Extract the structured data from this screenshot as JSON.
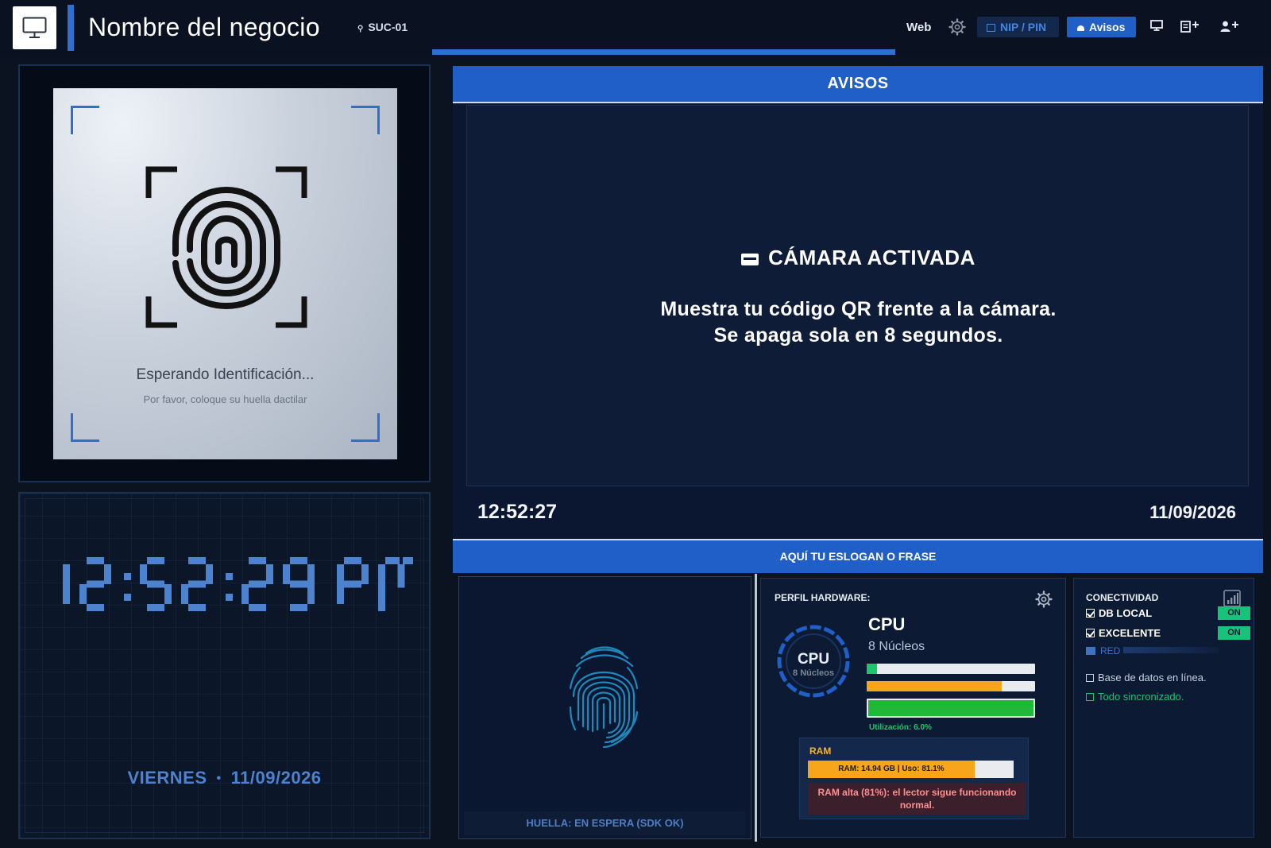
{
  "header": {
    "business_name": "Nombre del negocio",
    "branch": "SUC-01",
    "web_label": "Web",
    "nip_label": "NIP / PIN",
    "avisos_label": "Avisos",
    "icons": [
      "monitor-icon",
      "gear-icon",
      "keypad-icon",
      "bell-icon",
      "display-icon",
      "add-device-icon",
      "add-user-icon"
    ]
  },
  "reader": {
    "title": "Esperando Identificación...",
    "subtitle": "Por favor, coloque su huella dactilar"
  },
  "clock": {
    "time": "12:52:29 PM",
    "weekday": "VIERNES",
    "separator": "•",
    "date": "11/09/2026"
  },
  "avisos": {
    "header": "AVISOS",
    "camera_title": "CÁMARA ACTIVADA",
    "line1": "Muestra tu código QR frente a la cámara.",
    "line2": "Se apaga sola en 8 segundos.",
    "time": "12:52:27",
    "date": "11/09/2026"
  },
  "slogan": "AQUÍ TU ESLOGAN O FRASE",
  "fingerprint_panel": {
    "status": "HUELLA: EN ESPERA (SDK OK)"
  },
  "hardware": {
    "title": "PERFIL HARDWARE:",
    "ring_label": "CPU",
    "ring_sub": "8 Núcleos",
    "cpu_title": "CPU",
    "cpu_cores": "8 Núcleos",
    "bars": [
      {
        "fraction": 0.06,
        "color": "#1fc46b"
      },
      {
        "fraction": 0.8,
        "color": "#f7a51a"
      },
      {
        "fraction": 1.0,
        "color": "#1fb839"
      }
    ],
    "utilization": "Utilización: 6.0%",
    "ram_title": "RAM",
    "ram_text": "RAM: 14.94 GB | Uso: 81.1%",
    "ram_fraction": 0.811,
    "ram_alert": "RAM alta (81%): el lector sigue funcionando normal."
  },
  "connectivity": {
    "title": "CONECTIVIDAD",
    "rows": [
      {
        "label": "DB LOCAL",
        "badge": "ON"
      },
      {
        "label": "EXCELENTE",
        "badge": "ON"
      }
    ],
    "red_label": "RED",
    "db_status": "Base de datos en línea.",
    "sync_status": "Todo sincronizado."
  },
  "colors": {
    "accent": "#1f5fc7",
    "background": "#0b1220",
    "ok_green": "#17c27a",
    "warning_orange": "#f7a51a",
    "clock_blue": "#4d82cf"
  }
}
